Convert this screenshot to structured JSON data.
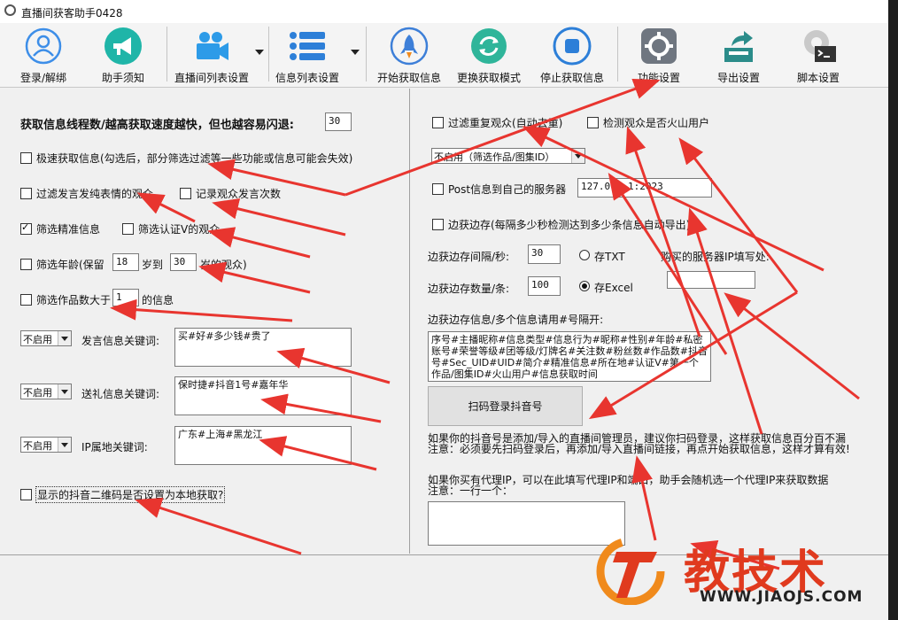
{
  "window": {
    "title": "直播间获客助手0428"
  },
  "toolbar": {
    "login": "登录/解绑",
    "help": "助手须知",
    "room_list": "直播间列表设置",
    "info_list": "信息列表设置",
    "start": "开始获取信息",
    "switch_mode": "更换获取模式",
    "stop": "停止获取信息",
    "features": "功能设置",
    "export": "导出设置",
    "script": "脚本设置"
  },
  "left": {
    "thread_label": "获取信息线程数/越高获取速度越快，但也越容易闪退:",
    "thread_value": "30",
    "fast_fetch": "极速获取信息(勾选后，部分筛选过滤等一些功能或信息可能会失效)",
    "filter_emoji": "过滤发言发纯表情的观众",
    "record_count": "记录观众发言次数",
    "filter_precise": "筛选精准信息",
    "filter_verified": "筛选认证V的观众",
    "age_prefix": "筛选年龄(保留",
    "age_min": "18",
    "age_to": "岁到",
    "age_max": "30",
    "age_suffix": "岁的观众)",
    "works_prefix": "筛选作品数大于",
    "works_value": "1",
    "works_suffix": "的信息",
    "kw_speech_select": "不启用",
    "kw_speech_label": "发言信息关键词:",
    "kw_speech_value": "买#好#多少钱#贵了",
    "kw_gift_select": "不启用",
    "kw_gift_label": "送礼信息关键词:",
    "kw_gift_value": "保时捷#抖音1号#嘉年华",
    "kw_ip_select": "不启用",
    "kw_ip_label": "IP属地关键词:",
    "kw_ip_value": "广东#上海#黑龙江",
    "qr_local": "显示的抖音二维码是否设置为本地获取?"
  },
  "right": {
    "dedupe": "过滤重复观众(自动去重)",
    "check_huoshan": "检测观众是否火山用户",
    "filter_select": "不启用（筛选作品/图集ID）",
    "post_server": "Post信息到自己的服务器",
    "server_addr": "127.0.0.1:2023",
    "auto_export": "边获边存(每隔多少秒检测达到多少条信息自动导出)",
    "interval_label": "边获边存间隔/秒:",
    "interval_value": "30",
    "txt_label": "存TXT",
    "buy_server_label": "购买的服务器IP填写处:",
    "count_label": "边获边存数量/条:",
    "count_value": "100",
    "excel_label": "存Excel",
    "buy_server_value": "",
    "fields_label": "边获边存信息/多个信息请用#号隔开:",
    "fields_value": "序号#主播昵称#信息类型#信息行为#昵称#性别#年龄#私密账号#荣誉等级#团等级/灯牌名#关注数#粉丝数#作品数#抖音号#Sec_UID#UID#简介#精准信息#所在地#认证V#第一个作品/图集ID#火山用户#信息获取时间",
    "scan_button": "扫码登录抖音号",
    "admin_note_1": "如果你的抖音号是添加/导入的直播间管理员，建议你扫码登录，这样获取信息百分百不漏",
    "admin_note_2": "注意：必须要先扫码登录后，再添加/导入直播间链接，再点开始获取信息，这样才算有效!",
    "proxy_note_1": "如果你买有代理IP，可以在此填写代理IP和端口，助手会随机选一个代理IP来获取数据",
    "proxy_note_2": "注意：一行一个：",
    "proxy_value": ""
  },
  "watermark": {
    "text": "教技术",
    "url": "WWW.JIAOJS.COM"
  },
  "colors": {
    "arrow": "#e8352f",
    "watermark": "#e03a1e",
    "watermark_orange": "#f08a1c"
  }
}
